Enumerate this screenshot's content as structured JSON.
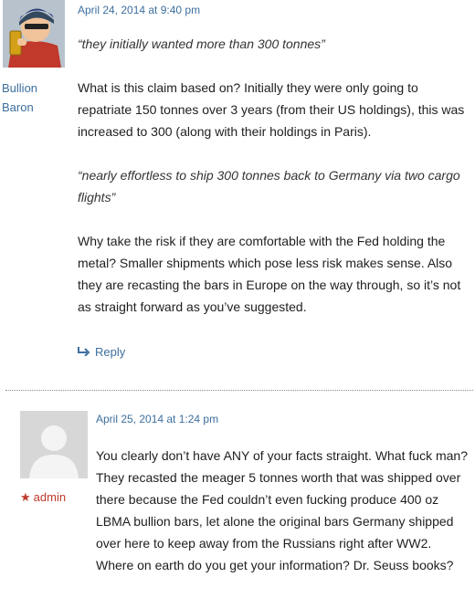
{
  "comments": [
    {
      "author": "Bullion Baron",
      "date": "April 24, 2014 at 9:40 pm",
      "paragraphs": [
        "“they initially wanted more than 300 tonnes”",
        "What is this claim based on? Initially they were only going to repatriate 150 tonnes over 3 years (from their US holdings), this was increased to 300 (along with their holdings in Paris).",
        "“nearly effortless to ship 300 tonnes back to Germany via two cargo flights”",
        "Why take the risk if they are comfortable with the Fed holding the metal? Smaller shipments which pose less risk makes sense. Also they are recasting the bars in Europe on the way through, so it’s not as straight forward as you’ve suggested."
      ],
      "reply_label": "Reply"
    },
    {
      "author": "admin",
      "date": "April 25, 2014 at 1:24 pm",
      "paragraphs": [
        "You clearly don’t have ANY of your facts straight. What fuck man? They recasted the meager 5 tonnes worth that was shipped over there because the Fed couldn’t even fucking produce 400 oz LBMA bullion bars, let alone the original bars Germany shipped over here to keep away from the Russians right after WW2. Where on earth do you get your information? Dr. Seuss books?"
      ]
    }
  ],
  "colors": {
    "link": "#3d6f9e",
    "admin": "#c0392b"
  },
  "icons": {
    "reply": "reply-arrow-icon",
    "admin_badge": "star-icon"
  }
}
